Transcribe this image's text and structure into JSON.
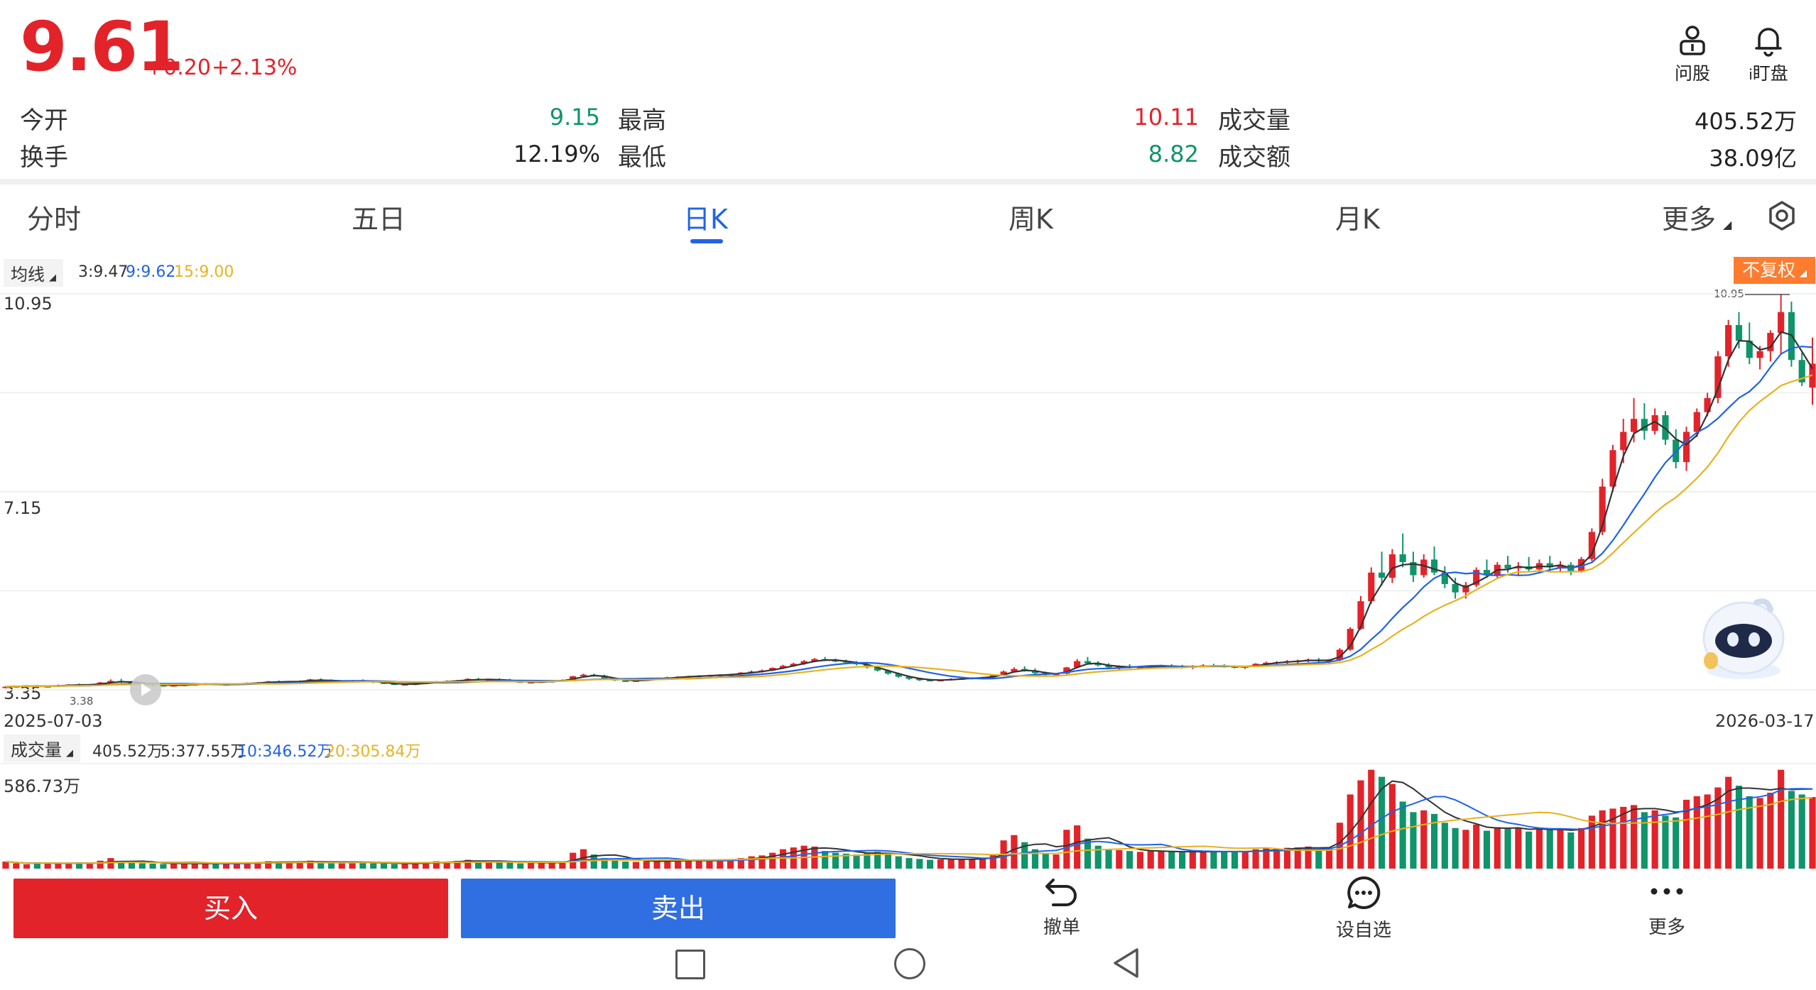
{
  "quote": {
    "price": "9.61",
    "change": "+0.20",
    "change_pct": "+2.13%"
  },
  "stats": [
    {
      "label": "今开",
      "value": "9.15",
      "color": "green"
    },
    {
      "label": "最高",
      "value": "10.11",
      "color": "red"
    },
    {
      "label": "成交量",
      "value": "405.52万",
      "color": "dark"
    },
    {
      "label": "换手",
      "value": "12.19%",
      "color": "dark"
    },
    {
      "label": "最低",
      "value": "8.82",
      "color": "green"
    },
    {
      "label": "成交额",
      "value": "38.09亿",
      "color": "dark"
    }
  ],
  "top_actions": {
    "ask": "问股",
    "watch": "盯盘"
  },
  "tabs": [
    "分时",
    "五日",
    "日K",
    "周K",
    "月K",
    "更多"
  ],
  "active_tab": "日K",
  "price_panel": {
    "indicator": "均线",
    "ma_legend": {
      "ma3": "3:9.47",
      "ma9": "9:9.62",
      "ma15": "15:9.00"
    },
    "adjust": "不复权",
    "y_high": "10.95",
    "y_mid": "7.15",
    "y_low": "3.35",
    "low_marker": "3.38",
    "high_marker": "10.95",
    "date_start": "2025-07-03",
    "date_end": "2026-03-17"
  },
  "volume_panel": {
    "indicator": "成交量",
    "legend": {
      "vol": "405.52万",
      "ma5": "5:377.55万",
      "ma10": "10:346.52万",
      "ma20": "20:305.84万"
    },
    "y_max": "586.73万"
  },
  "colors": {
    "up": "#e2232a",
    "down": "#10946a",
    "ma3": "#333333",
    "ma9": "#2163e6",
    "ma15": "#e8b21e",
    "accent": "#2163e6"
  },
  "chart_data": {
    "type": "candlestick",
    "x_start": "2025-07-03",
    "x_end": "2026-03-17",
    "ylim": [
      3.35,
      10.95
    ],
    "y_ticks": [
      10.95,
      7.15,
      3.35
    ],
    "high_mark": 10.95,
    "low_mark": 3.38,
    "candles_ohlc": [
      [
        3.4,
        3.42,
        3.38,
        3.41
      ],
      [
        3.41,
        3.43,
        3.39,
        3.42
      ],
      [
        3.42,
        3.44,
        3.4,
        3.43
      ],
      [
        3.43,
        3.44,
        3.4,
        3.41
      ],
      [
        3.41,
        3.43,
        3.39,
        3.42
      ],
      [
        3.42,
        3.45,
        3.41,
        3.44
      ],
      [
        3.44,
        3.46,
        3.42,
        3.45
      ],
      [
        3.45,
        3.47,
        3.43,
        3.44
      ],
      [
        3.44,
        3.46,
        3.42,
        3.45
      ],
      [
        3.45,
        3.5,
        3.44,
        3.49
      ],
      [
        3.49,
        3.55,
        3.47,
        3.52
      ],
      [
        3.52,
        3.56,
        3.48,
        3.5
      ],
      [
        3.5,
        3.52,
        3.46,
        3.48
      ],
      [
        3.48,
        3.5,
        3.44,
        3.46
      ],
      [
        3.46,
        3.48,
        3.42,
        3.44
      ],
      [
        3.44,
        3.46,
        3.41,
        3.43
      ],
      [
        3.43,
        3.45,
        3.41,
        3.44
      ],
      [
        3.44,
        3.46,
        3.42,
        3.45
      ],
      [
        3.45,
        3.47,
        3.43,
        3.46
      ],
      [
        3.46,
        3.48,
        3.44,
        3.47
      ],
      [
        3.47,
        3.48,
        3.44,
        3.45
      ],
      [
        3.45,
        3.47,
        3.43,
        3.46
      ],
      [
        3.46,
        3.48,
        3.44,
        3.47
      ],
      [
        3.47,
        3.49,
        3.45,
        3.48
      ],
      [
        3.48,
        3.5,
        3.46,
        3.49
      ],
      [
        3.49,
        3.52,
        3.47,
        3.51
      ],
      [
        3.51,
        3.53,
        3.48,
        3.5
      ],
      [
        3.5,
        3.52,
        3.48,
        3.51
      ],
      [
        3.51,
        3.53,
        3.49,
        3.52
      ],
      [
        3.52,
        3.56,
        3.5,
        3.55
      ],
      [
        3.55,
        3.57,
        3.52,
        3.53
      ],
      [
        3.53,
        3.55,
        3.5,
        3.51
      ],
      [
        3.51,
        3.53,
        3.49,
        3.52
      ],
      [
        3.52,
        3.54,
        3.5,
        3.53
      ],
      [
        3.53,
        3.55,
        3.51,
        3.52
      ],
      [
        3.52,
        3.53,
        3.48,
        3.49
      ],
      [
        3.49,
        3.51,
        3.46,
        3.47
      ],
      [
        3.47,
        3.49,
        3.44,
        3.45
      ],
      [
        3.45,
        3.47,
        3.43,
        3.46
      ],
      [
        3.46,
        3.48,
        3.44,
        3.47
      ],
      [
        3.47,
        3.5,
        3.46,
        3.49
      ],
      [
        3.49,
        3.52,
        3.48,
        3.51
      ],
      [
        3.51,
        3.53,
        3.49,
        3.52
      ],
      [
        3.52,
        3.54,
        3.5,
        3.53
      ],
      [
        3.53,
        3.57,
        3.52,
        3.56
      ],
      [
        3.56,
        3.58,
        3.53,
        3.54
      ],
      [
        3.54,
        3.56,
        3.52,
        3.55
      ],
      [
        3.55,
        3.57,
        3.53,
        3.54
      ],
      [
        3.54,
        3.56,
        3.5,
        3.51
      ],
      [
        3.51,
        3.53,
        3.48,
        3.49
      ],
      [
        3.49,
        3.51,
        3.47,
        3.5
      ],
      [
        3.5,
        3.52,
        3.48,
        3.51
      ],
      [
        3.51,
        3.53,
        3.49,
        3.52
      ],
      [
        3.52,
        3.55,
        3.51,
        3.54
      ],
      [
        3.54,
        3.62,
        3.53,
        3.61
      ],
      [
        3.61,
        3.66,
        3.59,
        3.64
      ],
      [
        3.64,
        3.66,
        3.6,
        3.62
      ],
      [
        3.62,
        3.64,
        3.56,
        3.57
      ],
      [
        3.57,
        3.58,
        3.52,
        3.53
      ],
      [
        3.53,
        3.55,
        3.5,
        3.52
      ],
      [
        3.52,
        3.54,
        3.5,
        3.53
      ],
      [
        3.53,
        3.56,
        3.52,
        3.55
      ],
      [
        3.55,
        3.58,
        3.54,
        3.57
      ],
      [
        3.57,
        3.6,
        3.56,
        3.59
      ],
      [
        3.59,
        3.61,
        3.57,
        3.6
      ],
      [
        3.6,
        3.62,
        3.58,
        3.61
      ],
      [
        3.61,
        3.63,
        3.59,
        3.62
      ],
      [
        3.62,
        3.64,
        3.6,
        3.63
      ],
      [
        3.63,
        3.65,
        3.61,
        3.64
      ],
      [
        3.64,
        3.66,
        3.62,
        3.65
      ],
      [
        3.65,
        3.69,
        3.64,
        3.68
      ],
      [
        3.68,
        3.72,
        3.66,
        3.7
      ],
      [
        3.7,
        3.74,
        3.68,
        3.72
      ],
      [
        3.72,
        3.78,
        3.71,
        3.77
      ],
      [
        3.77,
        3.83,
        3.75,
        3.81
      ],
      [
        3.81,
        3.87,
        3.79,
        3.85
      ],
      [
        3.85,
        3.92,
        3.83,
        3.9
      ],
      [
        3.9,
        3.96,
        3.88,
        3.94
      ],
      [
        3.94,
        3.98,
        3.9,
        3.92
      ],
      [
        3.92,
        3.95,
        3.88,
        3.9
      ],
      [
        3.9,
        3.93,
        3.86,
        3.88
      ],
      [
        3.88,
        3.9,
        3.82,
        3.84
      ],
      [
        3.84,
        3.86,
        3.76,
        3.78
      ],
      [
        3.78,
        3.8,
        3.7,
        3.72
      ],
      [
        3.72,
        3.74,
        3.64,
        3.66
      ],
      [
        3.66,
        3.68,
        3.58,
        3.6
      ],
      [
        3.6,
        3.62,
        3.54,
        3.56
      ],
      [
        3.56,
        3.58,
        3.52,
        3.54
      ],
      [
        3.54,
        3.56,
        3.51,
        3.53
      ],
      [
        3.53,
        3.55,
        3.51,
        3.54
      ],
      [
        3.54,
        3.57,
        3.53,
        3.56
      ],
      [
        3.56,
        3.58,
        3.54,
        3.57
      ],
      [
        3.57,
        3.59,
        3.55,
        3.58
      ],
      [
        3.58,
        3.6,
        3.56,
        3.59
      ],
      [
        3.59,
        3.64,
        3.58,
        3.63
      ],
      [
        3.63,
        3.72,
        3.62,
        3.7
      ],
      [
        3.7,
        3.78,
        3.68,
        3.75
      ],
      [
        3.75,
        3.8,
        3.7,
        3.72
      ],
      [
        3.72,
        3.76,
        3.65,
        3.67
      ],
      [
        3.67,
        3.7,
        3.62,
        3.64
      ],
      [
        3.64,
        3.67,
        3.62,
        3.66
      ],
      [
        3.66,
        3.79,
        3.65,
        3.78
      ],
      [
        3.78,
        3.94,
        3.76,
        3.9
      ],
      [
        3.9,
        3.98,
        3.84,
        3.86
      ],
      [
        3.86,
        3.9,
        3.8,
        3.82
      ],
      [
        3.82,
        3.86,
        3.76,
        3.78
      ],
      [
        3.78,
        3.82,
        3.74,
        3.8
      ],
      [
        3.8,
        3.84,
        3.76,
        3.78
      ],
      [
        3.78,
        3.81,
        3.75,
        3.79
      ],
      [
        3.79,
        3.82,
        3.76,
        3.8
      ],
      [
        3.8,
        3.83,
        3.77,
        3.81
      ],
      [
        3.81,
        3.84,
        3.78,
        3.8
      ],
      [
        3.8,
        3.83,
        3.76,
        3.78
      ],
      [
        3.78,
        3.82,
        3.75,
        3.8
      ],
      [
        3.8,
        3.84,
        3.78,
        3.82
      ],
      [
        3.82,
        3.85,
        3.79,
        3.81
      ],
      [
        3.81,
        3.84,
        3.78,
        3.8
      ],
      [
        3.8,
        3.82,
        3.76,
        3.78
      ],
      [
        3.78,
        3.81,
        3.75,
        3.8
      ],
      [
        3.8,
        3.86,
        3.79,
        3.85
      ],
      [
        3.85,
        3.89,
        3.82,
        3.87
      ],
      [
        3.87,
        3.9,
        3.84,
        3.88
      ],
      [
        3.88,
        3.92,
        3.85,
        3.9
      ],
      [
        3.9,
        3.93,
        3.86,
        3.91
      ],
      [
        3.91,
        3.95,
        3.88,
        3.93
      ],
      [
        3.93,
        3.96,
        3.88,
        3.9
      ],
      [
        3.9,
        3.94,
        3.86,
        3.92
      ],
      [
        3.92,
        4.15,
        3.9,
        4.12
      ],
      [
        4.12,
        4.55,
        4.1,
        4.52
      ],
      [
        4.52,
        5.15,
        4.5,
        5.05
      ],
      [
        5.05,
        5.7,
        5.0,
        5.6
      ],
      [
        5.6,
        6.0,
        5.35,
        5.5
      ],
      [
        5.5,
        6.05,
        5.4,
        5.95
      ],
      [
        5.95,
        6.35,
        5.7,
        5.8
      ],
      [
        5.8,
        6.0,
        5.42,
        5.55
      ],
      [
        5.55,
        5.95,
        5.5,
        5.85
      ],
      [
        5.85,
        6.1,
        5.55,
        5.6
      ],
      [
        5.6,
        5.72,
        5.3,
        5.38
      ],
      [
        5.38,
        5.5,
        5.1,
        5.22
      ],
      [
        5.22,
        5.42,
        5.1,
        5.36
      ],
      [
        5.36,
        5.7,
        5.32,
        5.65
      ],
      [
        5.65,
        5.85,
        5.5,
        5.55
      ],
      [
        5.55,
        5.8,
        5.5,
        5.75
      ],
      [
        5.75,
        5.92,
        5.6,
        5.68
      ],
      [
        5.68,
        5.8,
        5.55,
        5.72
      ],
      [
        5.72,
        5.9,
        5.62,
        5.66
      ],
      [
        5.66,
        5.85,
        5.6,
        5.78
      ],
      [
        5.78,
        5.92,
        5.62,
        5.7
      ],
      [
        5.7,
        5.82,
        5.6,
        5.75
      ],
      [
        5.75,
        5.8,
        5.55,
        5.62
      ],
      [
        5.62,
        5.9,
        5.6,
        5.86
      ],
      [
        5.86,
        6.45,
        5.82,
        6.38
      ],
      [
        6.38,
        7.4,
        6.32,
        7.25
      ],
      [
        7.25,
        8.05,
        7.15,
        7.95
      ],
      [
        7.95,
        8.55,
        7.7,
        8.3
      ],
      [
        8.3,
        8.95,
        8.1,
        8.55
      ],
      [
        8.55,
        8.85,
        8.15,
        8.32
      ],
      [
        8.32,
        8.75,
        8.25,
        8.62
      ],
      [
        8.62,
        8.7,
        8.05,
        8.15
      ],
      [
        8.15,
        8.35,
        7.6,
        7.72
      ],
      [
        7.72,
        8.4,
        7.55,
        8.3
      ],
      [
        8.3,
        8.75,
        8.2,
        8.68
      ],
      [
        8.68,
        9.05,
        8.6,
        8.95
      ],
      [
        8.95,
        9.85,
        8.85,
        9.75
      ],
      [
        9.75,
        10.45,
        9.55,
        10.35
      ],
      [
        10.35,
        10.6,
        9.9,
        10.05
      ],
      [
        10.05,
        10.4,
        9.6,
        9.72
      ],
      [
        9.72,
        9.95,
        9.5,
        9.85
      ],
      [
        9.85,
        10.25,
        9.65,
        10.2
      ],
      [
        10.2,
        10.95,
        9.8,
        10.6
      ],
      [
        10.6,
        10.8,
        9.55,
        9.68
      ],
      [
        9.68,
        9.82,
        9.18,
        9.25
      ],
      [
        9.15,
        10.11,
        8.82,
        9.61
      ]
    ],
    "volume": {
      "unit": "万",
      "ymax": 586.73,
      "values": [
        40,
        30,
        25,
        30,
        35,
        28,
        32,
        30,
        27,
        45,
        60,
        40,
        35,
        30,
        28,
        26,
        30,
        32,
        30,
        28,
        26,
        30,
        33,
        35,
        38,
        42,
        38,
        35,
        37,
        45,
        40,
        35,
        33,
        36,
        34,
        30,
        28,
        26,
        30,
        32,
        38,
        42,
        40,
        44,
        50,
        42,
        40,
        38,
        35,
        30,
        32,
        34,
        36,
        40,
        90,
        110,
        80,
        60,
        45,
        40,
        38,
        42,
        45,
        48,
        46,
        44,
        46,
        48,
        50,
        52,
        60,
        70,
        75,
        90,
        110,
        120,
        130,
        125,
        100,
        90,
        85,
        80,
        90,
        95,
        85,
        70,
        60,
        55,
        50,
        52,
        55,
        54,
        56,
        58,
        80,
        160,
        190,
        150,
        110,
        90,
        80,
        220,
        245,
        170,
        130,
        110,
        105,
        100,
        95,
        100,
        98,
        95,
        92,
        96,
        100,
        98,
        96,
        94,
        97,
        110,
        115,
        112,
        118,
        120,
        125,
        112,
        120,
        260,
        420,
        500,
        560,
        520,
        480,
        380,
        320,
        330,
        310,
        260,
        230,
        220,
        250,
        215,
        235,
        225,
        230,
        210,
        225,
        220,
        228,
        205,
        230,
        300,
        330,
        340,
        350,
        360,
        320,
        330,
        300,
        290,
        390,
        410,
        420,
        460,
        520,
        470,
        410,
        400,
        430,
        560,
        440,
        420,
        405.52
      ]
    }
  }
}
